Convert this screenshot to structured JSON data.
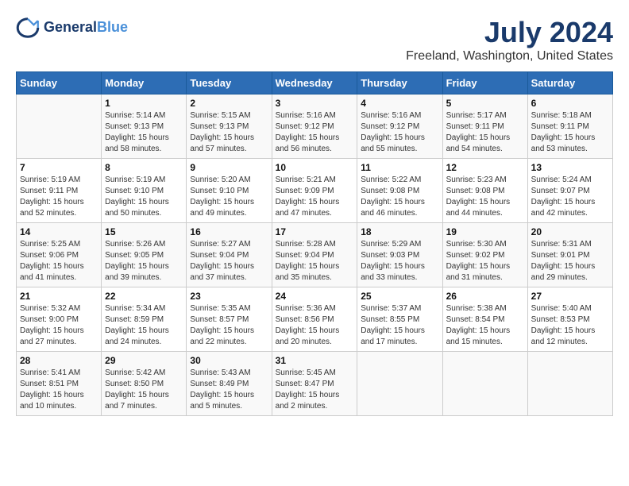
{
  "header": {
    "logo_line1": "General",
    "logo_line2": "Blue",
    "title": "July 2024",
    "subtitle": "Freeland, Washington, United States"
  },
  "days_of_week": [
    "Sunday",
    "Monday",
    "Tuesday",
    "Wednesday",
    "Thursday",
    "Friday",
    "Saturday"
  ],
  "weeks": [
    [
      {
        "day": "",
        "info": ""
      },
      {
        "day": "1",
        "info": "Sunrise: 5:14 AM\nSunset: 9:13 PM\nDaylight: 15 hours\nand 58 minutes."
      },
      {
        "day": "2",
        "info": "Sunrise: 5:15 AM\nSunset: 9:13 PM\nDaylight: 15 hours\nand 57 minutes."
      },
      {
        "day": "3",
        "info": "Sunrise: 5:16 AM\nSunset: 9:12 PM\nDaylight: 15 hours\nand 56 minutes."
      },
      {
        "day": "4",
        "info": "Sunrise: 5:16 AM\nSunset: 9:12 PM\nDaylight: 15 hours\nand 55 minutes."
      },
      {
        "day": "5",
        "info": "Sunrise: 5:17 AM\nSunset: 9:11 PM\nDaylight: 15 hours\nand 54 minutes."
      },
      {
        "day": "6",
        "info": "Sunrise: 5:18 AM\nSunset: 9:11 PM\nDaylight: 15 hours\nand 53 minutes."
      }
    ],
    [
      {
        "day": "7",
        "info": "Sunrise: 5:19 AM\nSunset: 9:11 PM\nDaylight: 15 hours\nand 52 minutes."
      },
      {
        "day": "8",
        "info": "Sunrise: 5:19 AM\nSunset: 9:10 PM\nDaylight: 15 hours\nand 50 minutes."
      },
      {
        "day": "9",
        "info": "Sunrise: 5:20 AM\nSunset: 9:10 PM\nDaylight: 15 hours\nand 49 minutes."
      },
      {
        "day": "10",
        "info": "Sunrise: 5:21 AM\nSunset: 9:09 PM\nDaylight: 15 hours\nand 47 minutes."
      },
      {
        "day": "11",
        "info": "Sunrise: 5:22 AM\nSunset: 9:08 PM\nDaylight: 15 hours\nand 46 minutes."
      },
      {
        "day": "12",
        "info": "Sunrise: 5:23 AM\nSunset: 9:08 PM\nDaylight: 15 hours\nand 44 minutes."
      },
      {
        "day": "13",
        "info": "Sunrise: 5:24 AM\nSunset: 9:07 PM\nDaylight: 15 hours\nand 42 minutes."
      }
    ],
    [
      {
        "day": "14",
        "info": "Sunrise: 5:25 AM\nSunset: 9:06 PM\nDaylight: 15 hours\nand 41 minutes."
      },
      {
        "day": "15",
        "info": "Sunrise: 5:26 AM\nSunset: 9:05 PM\nDaylight: 15 hours\nand 39 minutes."
      },
      {
        "day": "16",
        "info": "Sunrise: 5:27 AM\nSunset: 9:04 PM\nDaylight: 15 hours\nand 37 minutes."
      },
      {
        "day": "17",
        "info": "Sunrise: 5:28 AM\nSunset: 9:04 PM\nDaylight: 15 hours\nand 35 minutes."
      },
      {
        "day": "18",
        "info": "Sunrise: 5:29 AM\nSunset: 9:03 PM\nDaylight: 15 hours\nand 33 minutes."
      },
      {
        "day": "19",
        "info": "Sunrise: 5:30 AM\nSunset: 9:02 PM\nDaylight: 15 hours\nand 31 minutes."
      },
      {
        "day": "20",
        "info": "Sunrise: 5:31 AM\nSunset: 9:01 PM\nDaylight: 15 hours\nand 29 minutes."
      }
    ],
    [
      {
        "day": "21",
        "info": "Sunrise: 5:32 AM\nSunset: 9:00 PM\nDaylight: 15 hours\nand 27 minutes."
      },
      {
        "day": "22",
        "info": "Sunrise: 5:34 AM\nSunset: 8:59 PM\nDaylight: 15 hours\nand 24 minutes."
      },
      {
        "day": "23",
        "info": "Sunrise: 5:35 AM\nSunset: 8:57 PM\nDaylight: 15 hours\nand 22 minutes."
      },
      {
        "day": "24",
        "info": "Sunrise: 5:36 AM\nSunset: 8:56 PM\nDaylight: 15 hours\nand 20 minutes."
      },
      {
        "day": "25",
        "info": "Sunrise: 5:37 AM\nSunset: 8:55 PM\nDaylight: 15 hours\nand 17 minutes."
      },
      {
        "day": "26",
        "info": "Sunrise: 5:38 AM\nSunset: 8:54 PM\nDaylight: 15 hours\nand 15 minutes."
      },
      {
        "day": "27",
        "info": "Sunrise: 5:40 AM\nSunset: 8:53 PM\nDaylight: 15 hours\nand 12 minutes."
      }
    ],
    [
      {
        "day": "28",
        "info": "Sunrise: 5:41 AM\nSunset: 8:51 PM\nDaylight: 15 hours\nand 10 minutes."
      },
      {
        "day": "29",
        "info": "Sunrise: 5:42 AM\nSunset: 8:50 PM\nDaylight: 15 hours\nand 7 minutes."
      },
      {
        "day": "30",
        "info": "Sunrise: 5:43 AM\nSunset: 8:49 PM\nDaylight: 15 hours\nand 5 minutes."
      },
      {
        "day": "31",
        "info": "Sunrise: 5:45 AM\nSunset: 8:47 PM\nDaylight: 15 hours\nand 2 minutes."
      },
      {
        "day": "",
        "info": ""
      },
      {
        "day": "",
        "info": ""
      },
      {
        "day": "",
        "info": ""
      }
    ]
  ]
}
